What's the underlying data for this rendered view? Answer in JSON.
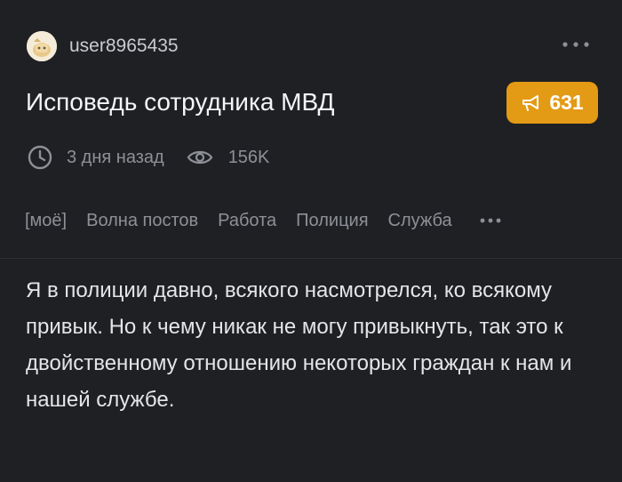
{
  "post": {
    "author": "user8965435",
    "title": "Исповедь сотрудника МВД",
    "rating": "631",
    "time_ago": "3 дня назад",
    "views": "156K",
    "tags": [
      "[моё]",
      "Волна постов",
      "Работа",
      "Полиция",
      "Служба"
    ],
    "body": "Я в полиции давно, всякого насмотрелся, ко всякому привык. Но к чему никак не могу привыкнуть, так это к двойственному отношению некоторых граждан к нам и нашей службе."
  },
  "icons": {
    "avatar": "avatar-image",
    "more_top": "more-horizontal-icon",
    "rating": "megaphone-icon",
    "time": "clock-icon",
    "views": "eye-icon",
    "tags_more": "more-horizontal-icon"
  },
  "colors": {
    "background": "#1f2024",
    "accent": "#e39a15",
    "text_primary": "#f5f5f7",
    "text_secondary": "#8e9097"
  }
}
